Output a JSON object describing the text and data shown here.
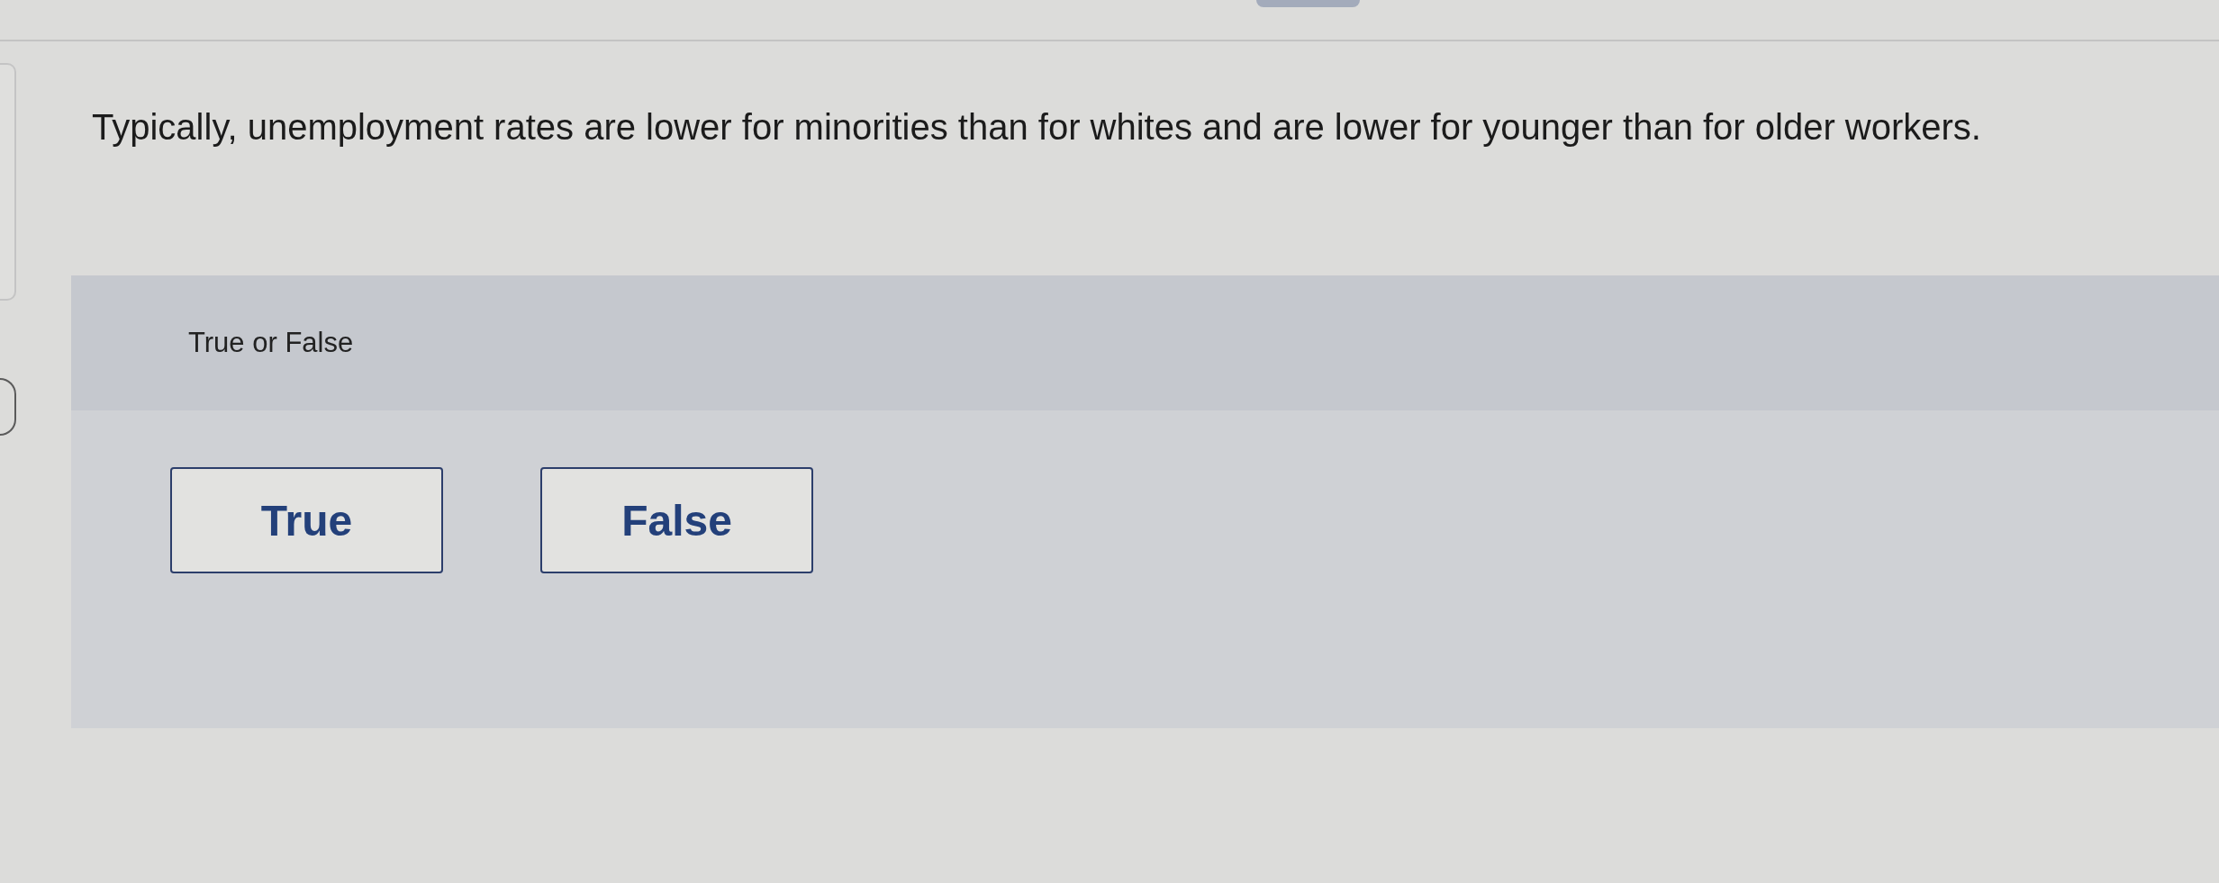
{
  "question": {
    "text": "Typically, unemployment rates are lower for minorities than for whites and are lower for younger than for older workers."
  },
  "answer_panel": {
    "prompt": "True or False",
    "options": [
      {
        "label": "True",
        "selected": false
      },
      {
        "label": "False",
        "selected": false
      }
    ]
  }
}
